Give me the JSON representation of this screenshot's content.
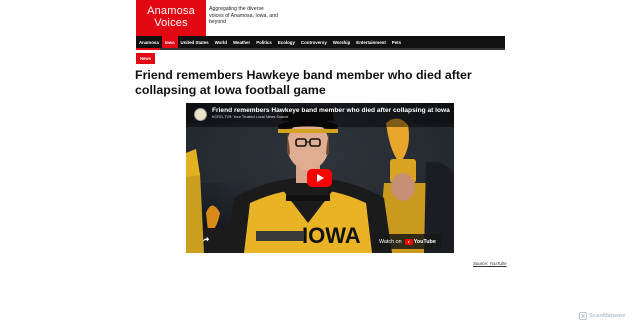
{
  "site": {
    "logo_line1": "Anamosa",
    "logo_line2": "Voices",
    "tagline": "Aggregating the diverse voices of Anamosa, Iowa, and beyond",
    "brand_color": "#e30613"
  },
  "nav": {
    "items": [
      {
        "label": "Anamosa",
        "active": false
      },
      {
        "label": "Iowa",
        "active": true
      },
      {
        "label": "United States",
        "active": false
      },
      {
        "label": "World",
        "active": false
      },
      {
        "label": "Weather",
        "active": false
      },
      {
        "label": "Politics",
        "active": false
      },
      {
        "label": "Ecology",
        "active": false
      },
      {
        "label": "Controversy",
        "active": false
      },
      {
        "label": "Worship",
        "active": false
      },
      {
        "label": "Entertainment",
        "active": false
      },
      {
        "label": "Pets",
        "active": false
      }
    ]
  },
  "article": {
    "category_badge": "News",
    "headline": "Friend remembers Hawkeye band member who died after collapsing at Iowa football game",
    "source_label": "Source: YouTube"
  },
  "video": {
    "title": "Friend remembers Hawkeye band member who died after collapsing at Iowa football game",
    "channel": "KCRG-TV9: Your Trusted Local News Source",
    "watch_on_label": "Watch on",
    "youtube_label": "YouTube",
    "play_icon": "play-icon",
    "share_icon": "share-icon"
  },
  "watermark": {
    "label": "ScanMalware"
  }
}
